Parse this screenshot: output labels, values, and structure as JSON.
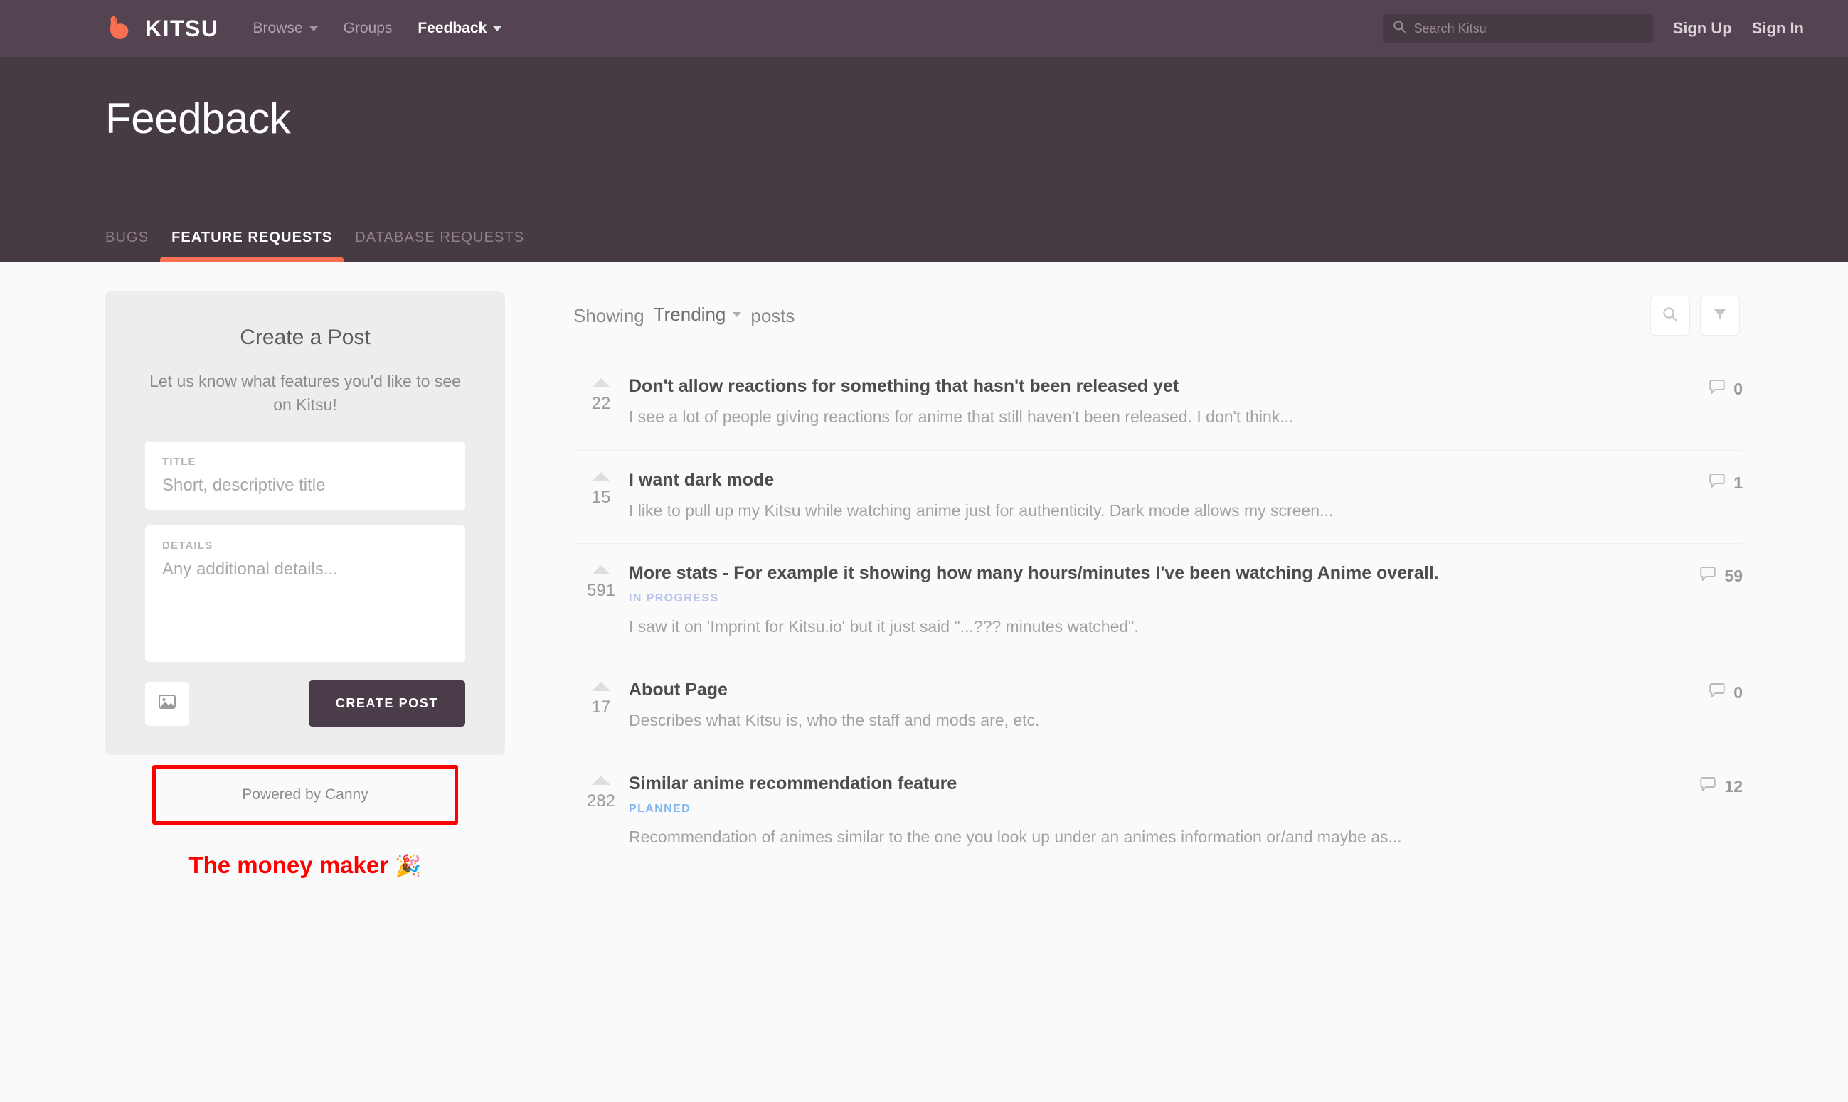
{
  "nav": {
    "brand": "KITSU",
    "links": [
      {
        "label": "Browse",
        "has_caret": true,
        "active": false
      },
      {
        "label": "Groups",
        "has_caret": false,
        "active": false
      },
      {
        "label": "Feedback",
        "has_caret": true,
        "active": true
      }
    ],
    "search_placeholder": "Search Kitsu",
    "sign_up": "Sign Up",
    "sign_in": "Sign In"
  },
  "banner": {
    "title": "Feedback",
    "tabs": [
      {
        "label": "BUGS",
        "active": false
      },
      {
        "label": "FEATURE REQUESTS",
        "active": true
      },
      {
        "label": "DATABASE REQUESTS",
        "active": false
      }
    ]
  },
  "sidebar": {
    "create_title": "Create a Post",
    "create_subtitle": "Let us know what features you'd like to see on Kitsu!",
    "title_field": {
      "label": "TITLE",
      "placeholder": "Short, descriptive title",
      "value": ""
    },
    "details_field": {
      "label": "DETAILS",
      "placeholder": "Any additional details...",
      "value": ""
    },
    "create_button": "CREATE POST",
    "powered_by": "Powered by Canny",
    "annotation": "The money maker",
    "annotation_emoji": "🎉",
    "annotation_color": "#ff0000"
  },
  "list_header": {
    "showing_prefix": "Showing",
    "sort_value": "Trending",
    "showing_suffix": "posts"
  },
  "posts": [
    {
      "votes": "22",
      "title": "Don't allow reactions for something that hasn't been released yet",
      "status": "",
      "description": "I see a lot of people giving reactions for anime that still haven't been released. I don't think...",
      "comments": "0"
    },
    {
      "votes": "15",
      "title": "I want dark mode",
      "status": "",
      "description": "I like to pull up my Kitsu while watching anime just for authenticity. Dark mode allows my screen...",
      "comments": "1"
    },
    {
      "votes": "591",
      "title": "More stats - For example it showing how many hours/minutes I've been watching Anime overall.",
      "status": "IN PROGRESS",
      "status_class": "in-progress",
      "description": "I saw it on 'Imprint for Kitsu.io' but it just said \"...??? minutes watched\".",
      "comments": "59"
    },
    {
      "votes": "17",
      "title": "About Page",
      "status": "",
      "description": "Describes what Kitsu is, who the staff and mods are, etc.",
      "comments": "0"
    },
    {
      "votes": "282",
      "title": "Similar anime recommendation feature",
      "status": "PLANNED",
      "status_class": "planned",
      "description": "Recommendation of animes similar to the one you look up under an animes information or/and maybe as...",
      "comments": "12"
    }
  ],
  "colors": {
    "nav_bg": "#544452",
    "banner_bg": "#463a44",
    "accent": "#f86f52",
    "button_bg": "#4b3c49",
    "page_bg": "#fafafa",
    "planned": "#7fb6f2",
    "in_progress": "#b6c4ec"
  }
}
